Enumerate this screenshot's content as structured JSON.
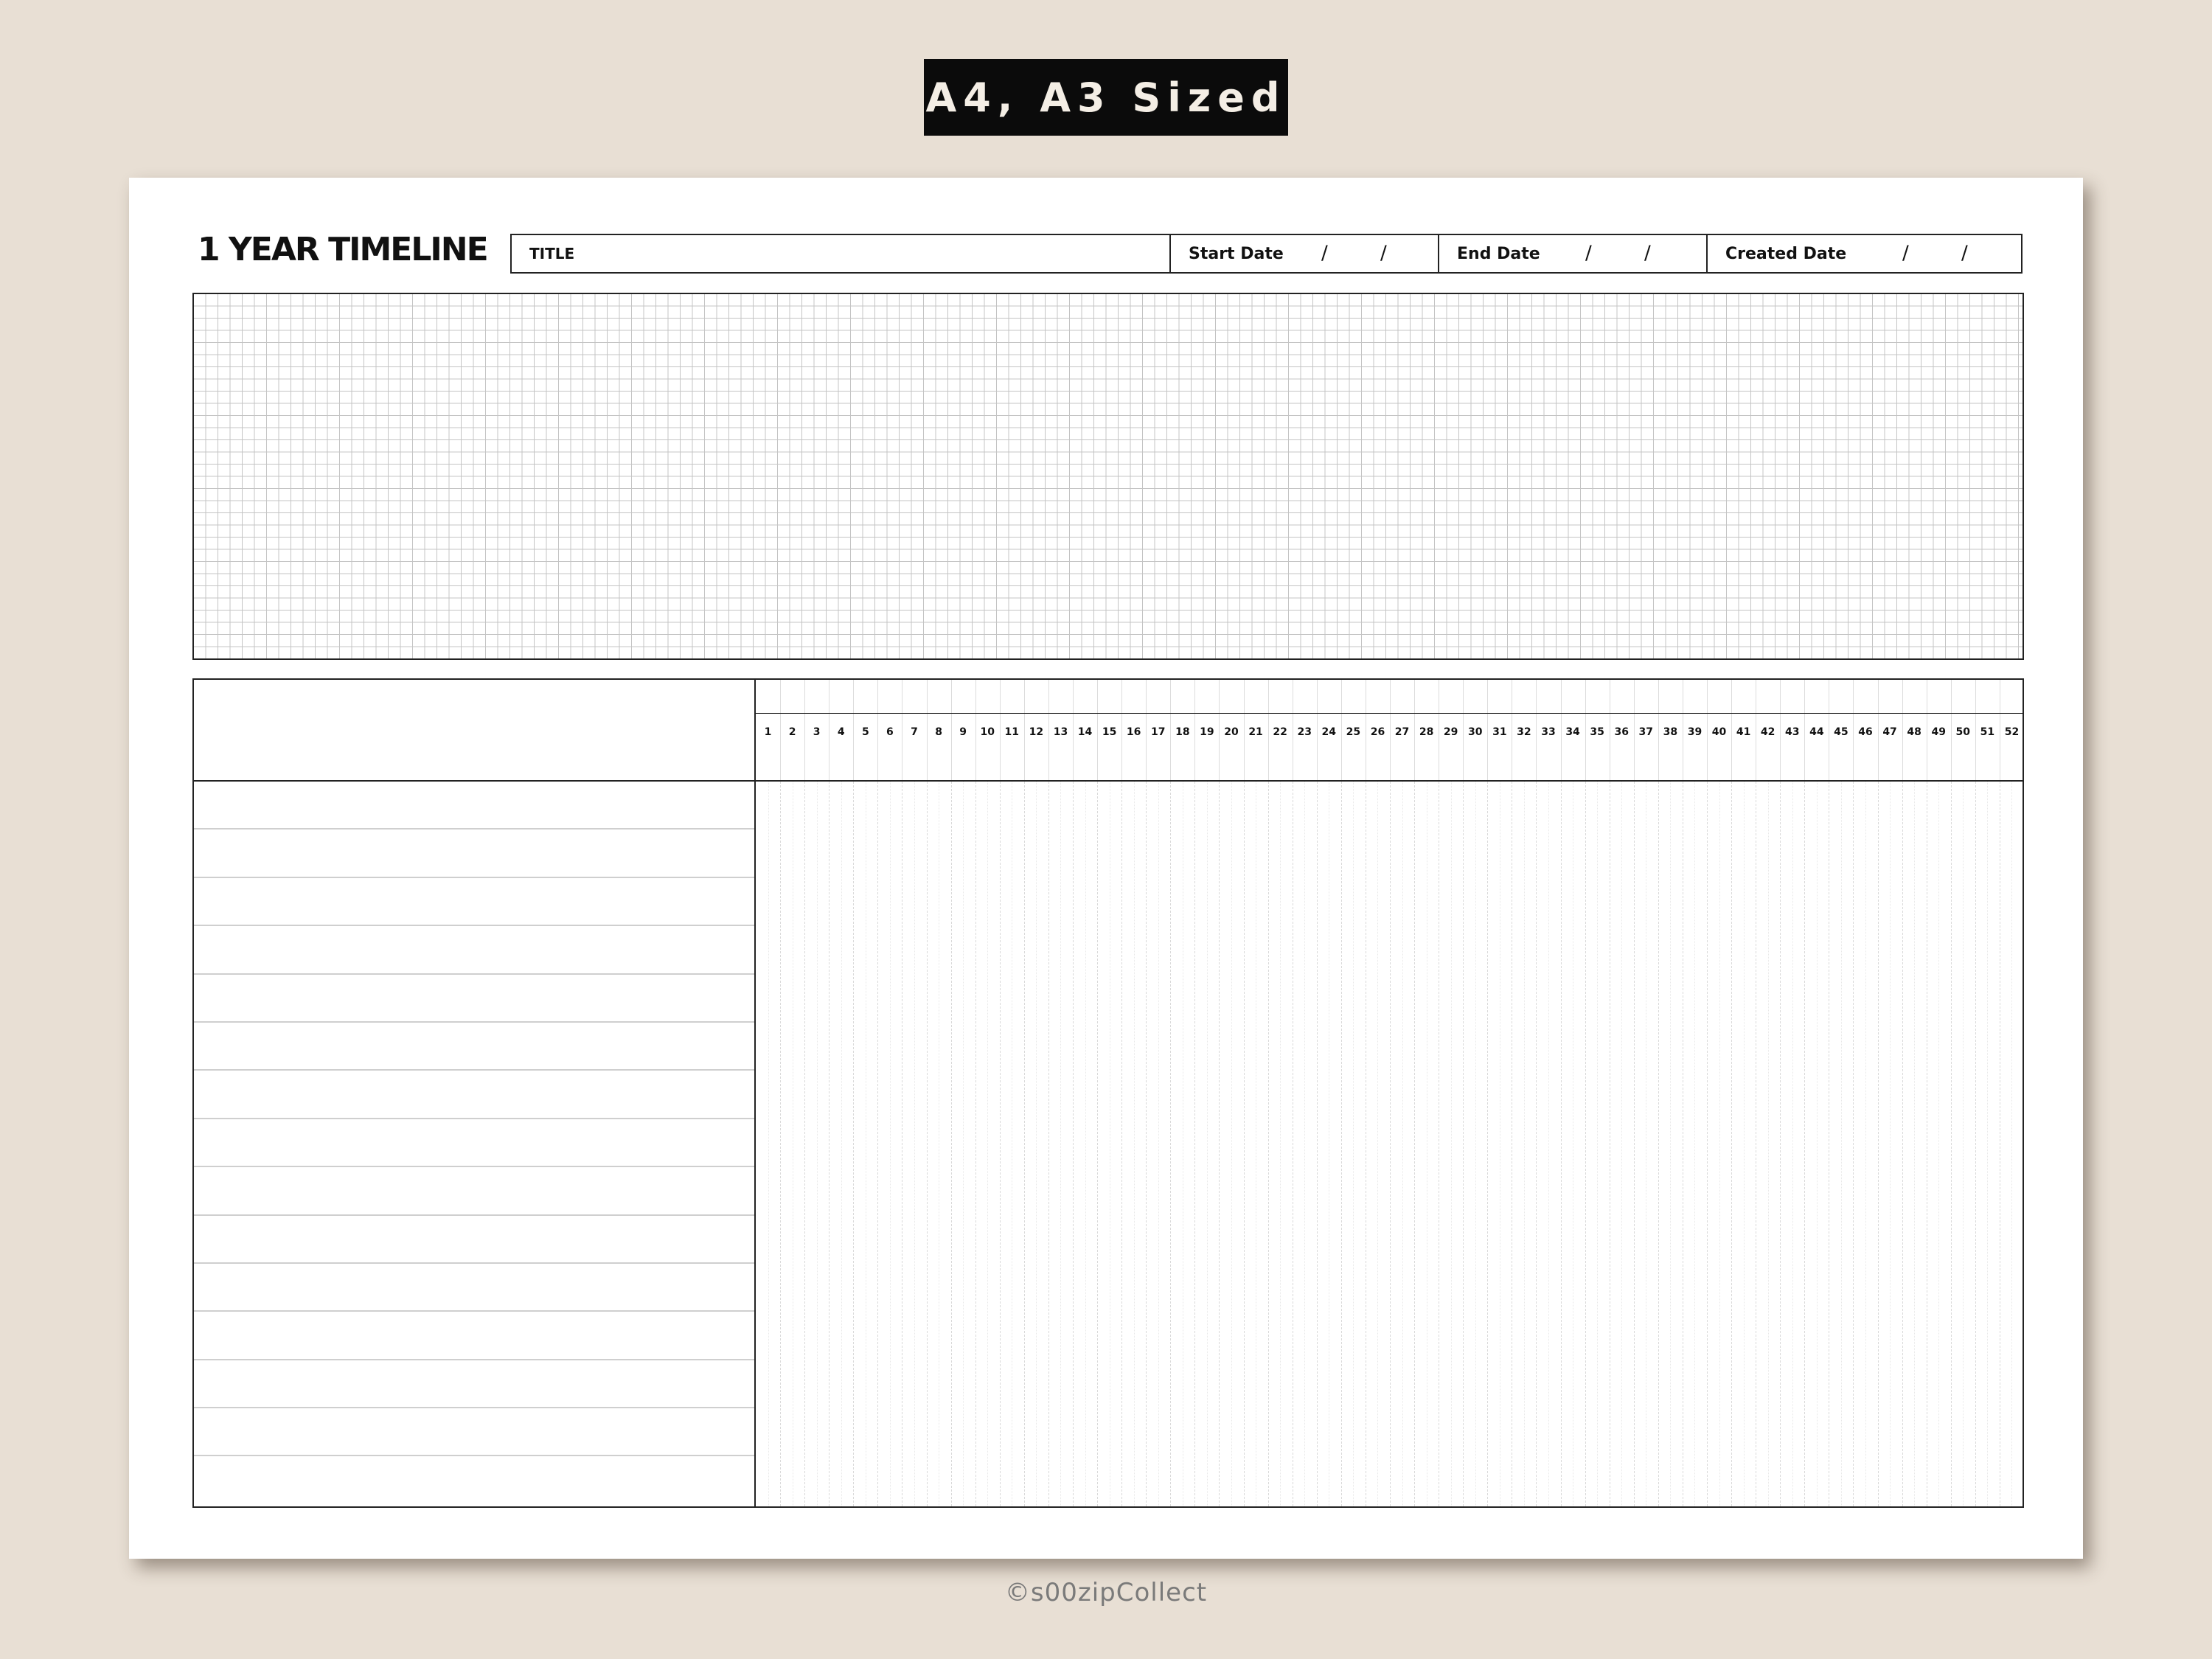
{
  "badge": {
    "label": "A4, A3 Sized"
  },
  "sheet": {
    "heading": "1 YEAR TIMELINE",
    "header": {
      "title_label": "TITLE",
      "start_label": "Start Date",
      "end_label": "End Date",
      "created_label": "Created Date",
      "date_separator": "/"
    },
    "timeline": {
      "weeks": [
        "1",
        "2",
        "3",
        "4",
        "5",
        "6",
        "7",
        "8",
        "9",
        "10",
        "11",
        "12",
        "13",
        "14",
        "15",
        "16",
        "17",
        "18",
        "19",
        "20",
        "21",
        "22",
        "23",
        "24",
        "25",
        "26",
        "27",
        "28",
        "29",
        "30",
        "31",
        "32",
        "33",
        "34",
        "35",
        "36",
        "37",
        "38",
        "39",
        "40",
        "41",
        "42",
        "43",
        "44",
        "45",
        "46",
        "47",
        "48",
        "49",
        "50",
        "51",
        "52"
      ],
      "task_row_count": 15
    }
  },
  "footer": {
    "copyright": "©s00zipCollect"
  }
}
